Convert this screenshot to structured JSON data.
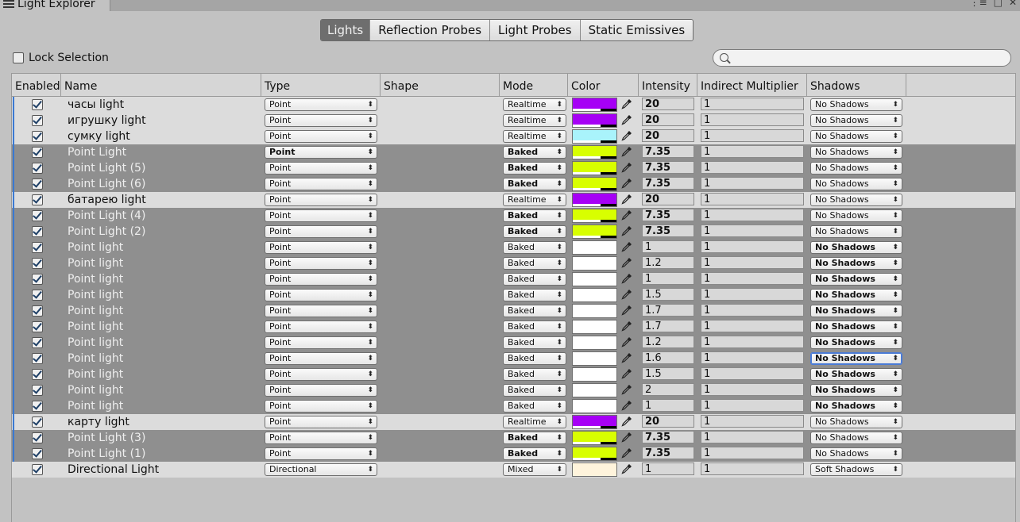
{
  "window": {
    "title": "Light Explorer"
  },
  "tabs": [
    "Lights",
    "Reflection Probes",
    "Light Probes",
    "Static Emissives"
  ],
  "lock_label": "Lock Selection",
  "search": {
    "placeholder": ""
  },
  "columns": [
    "Enabled",
    "Name",
    "Type",
    "Shape",
    "Mode",
    "Color",
    "Intensity",
    "Indirect Multiplier",
    "Shadows"
  ],
  "colors": {
    "accent": "#3a79d2",
    "purple": "#a600f5",
    "cyan": "#a9f3fb",
    "yellow": "#d8ff00",
    "white": "#ffffff",
    "cream": "#fff4dc",
    "selected_row": "#8f8f8f"
  },
  "rows": [
    {
      "name": "часы light",
      "type": "Point",
      "mode": "Realtime",
      "color": "#a600f5",
      "intensity": "20",
      "indirect": "1",
      "shadows": "No Shadows",
      "selected": false
    },
    {
      "name": "игрушку light",
      "type": "Point",
      "mode": "Realtime",
      "color": "#a600f5",
      "intensity": "20",
      "indirect": "1",
      "shadows": "No Shadows",
      "selected": false
    },
    {
      "name": "сумку light",
      "type": "Point",
      "mode": "Realtime",
      "color": "#a9f3fb",
      "intensity": "20",
      "indirect": "1",
      "shadows": "No Shadows",
      "selected": false
    },
    {
      "name": "Point Light",
      "type": "Point",
      "mode": "Baked",
      "color": "#d8ff00",
      "intensity": "7.35",
      "indirect": "1",
      "shadows": "No Shadows",
      "selected": true,
      "type_bold": true
    },
    {
      "name": "Point Light (5)",
      "type": "Point",
      "mode": "Baked",
      "color": "#d8ff00",
      "intensity": "7.35",
      "indirect": "1",
      "shadows": "No Shadows",
      "selected": true
    },
    {
      "name": "Point Light (6)",
      "type": "Point",
      "mode": "Baked",
      "color": "#d8ff00",
      "intensity": "7.35",
      "indirect": "1",
      "shadows": "No Shadows",
      "selected": true
    },
    {
      "name": "батарею light",
      "type": "Point",
      "mode": "Realtime",
      "color": "#a600f5",
      "intensity": "20",
      "indirect": "1",
      "shadows": "No Shadows",
      "selected": false
    },
    {
      "name": "Point Light (4)",
      "type": "Point",
      "mode": "Baked",
      "color": "#d8ff00",
      "intensity": "7.35",
      "indirect": "1",
      "shadows": "No Shadows",
      "selected": true
    },
    {
      "name": "Point Light (2)",
      "type": "Point",
      "mode": "Baked",
      "color": "#d8ff00",
      "intensity": "7.35",
      "indirect": "1",
      "shadows": "No Shadows",
      "selected": true
    },
    {
      "name": "Point light",
      "type": "Point",
      "mode": "Baked",
      "color": "#ffffff",
      "intensity": "1",
      "indirect": "1",
      "shadows": "No Shadows",
      "selected": true
    },
    {
      "name": "Point light",
      "type": "Point",
      "mode": "Baked",
      "color": "#ffffff",
      "intensity": "1.2",
      "indirect": "1",
      "shadows": "No Shadows",
      "selected": true
    },
    {
      "name": "Point light",
      "type": "Point",
      "mode": "Baked",
      "color": "#ffffff",
      "intensity": "1",
      "indirect": "1",
      "shadows": "No Shadows",
      "selected": true
    },
    {
      "name": "Point light",
      "type": "Point",
      "mode": "Baked",
      "color": "#ffffff",
      "intensity": "1.5",
      "indirect": "1",
      "shadows": "No Shadows",
      "selected": true
    },
    {
      "name": "Point light",
      "type": "Point",
      "mode": "Baked",
      "color": "#ffffff",
      "intensity": "1.7",
      "indirect": "1",
      "shadows": "No Shadows",
      "selected": true
    },
    {
      "name": "Point light",
      "type": "Point",
      "mode": "Baked",
      "color": "#ffffff",
      "intensity": "1.7",
      "indirect": "1",
      "shadows": "No Shadows",
      "selected": true
    },
    {
      "name": "Point light",
      "type": "Point",
      "mode": "Baked",
      "color": "#ffffff",
      "intensity": "1.2",
      "indirect": "1",
      "shadows": "No Shadows",
      "selected": true
    },
    {
      "name": "Point light",
      "type": "Point",
      "mode": "Baked",
      "color": "#ffffff",
      "intensity": "1.6",
      "indirect": "1",
      "shadows": "No Shadows",
      "selected": true,
      "focused": true
    },
    {
      "name": "Point light",
      "type": "Point",
      "mode": "Baked",
      "color": "#ffffff",
      "intensity": "1.5",
      "indirect": "1",
      "shadows": "No Shadows",
      "selected": true
    },
    {
      "name": "Point light",
      "type": "Point",
      "mode": "Baked",
      "color": "#ffffff",
      "intensity": "2",
      "indirect": "1",
      "shadows": "No Shadows",
      "selected": true
    },
    {
      "name": "Point light",
      "type": "Point",
      "mode": "Baked",
      "color": "#ffffff",
      "intensity": "1",
      "indirect": "1",
      "shadows": "No Shadows",
      "selected": true
    },
    {
      "name": "карту light",
      "type": "Point",
      "mode": "Realtime",
      "color": "#a600f5",
      "intensity": "20",
      "indirect": "1",
      "shadows": "No Shadows",
      "selected": false
    },
    {
      "name": "Point Light (3)",
      "type": "Point",
      "mode": "Baked",
      "color": "#d8ff00",
      "intensity": "7.35",
      "indirect": "1",
      "shadows": "No Shadows",
      "selected": true
    },
    {
      "name": "Point Light (1)",
      "type": "Point",
      "mode": "Baked",
      "color": "#d8ff00",
      "intensity": "7.35",
      "indirect": "1",
      "shadows": "No Shadows",
      "selected": true
    },
    {
      "name": "Directional Light",
      "type": "Directional",
      "mode": "Mixed",
      "color": "#fff4dc",
      "intensity": "1",
      "indirect": "1",
      "shadows": "Soft Shadows",
      "selected": false
    }
  ]
}
